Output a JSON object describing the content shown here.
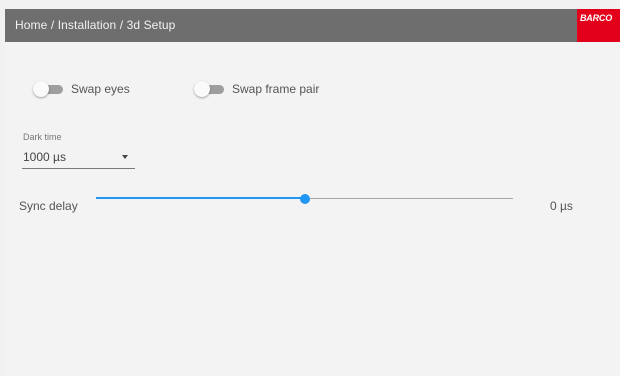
{
  "header": {
    "breadcrumb": "Home / Installation / 3d Setup",
    "logo_text": "BARCO",
    "background": "#6e6e6e",
    "logo_background": "#e2001a"
  },
  "toggles": [
    {
      "label": "Swap eyes",
      "checked": false
    },
    {
      "label": "Swap frame pair",
      "checked": false
    }
  ],
  "dark_time": {
    "caption": "Dark time",
    "value": "1000 µs"
  },
  "sync_delay": {
    "label": "Sync delay",
    "value_text": "0 µs",
    "position_fraction": 0.5,
    "accent": "#2196f3"
  }
}
